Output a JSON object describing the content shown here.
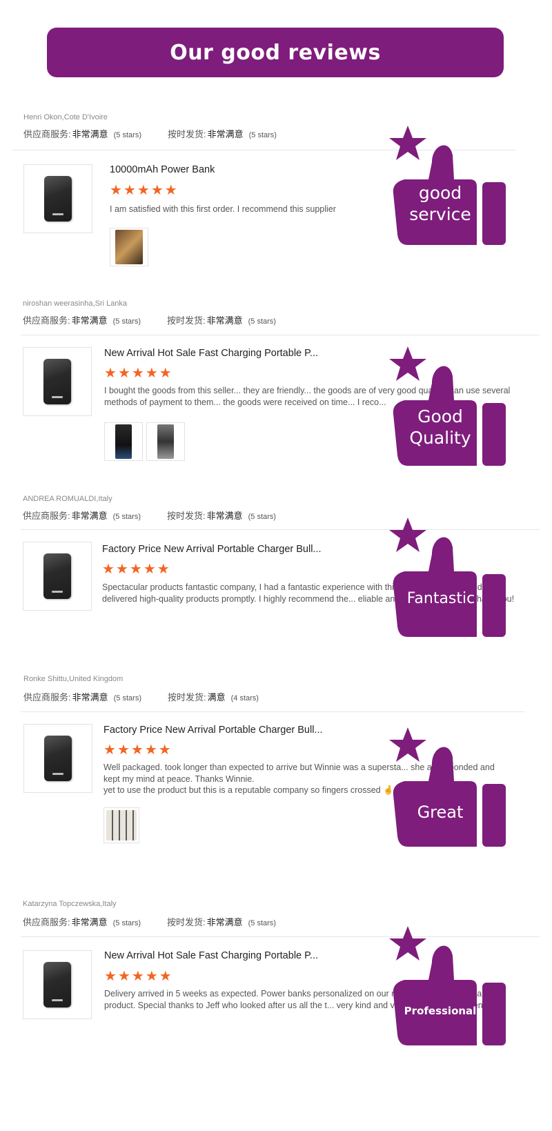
{
  "header": {
    "title": "Our good reviews"
  },
  "labels": {
    "supplier_service": "供应商服务:",
    "on_time_delivery": "按时发货:"
  },
  "colors": {
    "brand": "#7e1d7c",
    "star": "#f26522"
  },
  "reviews": [
    {
      "reviewer": "Henri Okon,Cote D'Ivoire",
      "supplier_value": "非常满意",
      "supplier_stars": "(5 stars)",
      "delivery_value": "非常满意",
      "delivery_stars": "(5 stars)",
      "product_title": "10000mAh Power Bank",
      "rating": 5,
      "comment": "I am satisfied with this first order. I recommend this supplier",
      "badge": "good service"
    },
    {
      "reviewer": "niroshan weerasinha,Sri Lanka",
      "supplier_value": "非常满意",
      "supplier_stars": "(5 stars)",
      "delivery_value": "非常满意",
      "delivery_stars": "(5 stars)",
      "product_title": "New Arrival Hot Sale Fast Charging Portable P...",
      "rating": 5,
      "comment": "I bought the goods from this seller... they are friendly... the goods are of very good qua... u can use several methods of payment to them... the goods were received on time... I reco...",
      "badge": "Good Quality"
    },
    {
      "reviewer": "ANDREA ROMUALDI,Italy",
      "supplier_value": "非常满意",
      "supplier_stars": "(5 stars)",
      "delivery_value": "非常满意",
      "delivery_stars": "(5 stars)",
      "product_title": "Factory Price New Arrival Portable Charger Bull...",
      "rating": 5,
      "comment": "Spectacular products fantastic company, I had a fantastic experience with this s... op ch service and delivered high-quality products promptly. I highly recommend the... eliable and trustworthy seller. Thank you!",
      "badge": "Fantastic"
    },
    {
      "reviewer": "Ronke Shittu,United Kingdom",
      "supplier_value": "非常满意",
      "supplier_stars": "(5 stars)",
      "delivery_value": "满意",
      "delivery_stars": "(4 stars)",
      "product_title": "Factory Price New Arrival Portable Charger Bull...",
      "rating": 5,
      "comment_lines": [
        "Well packaged. took longer than expected to arrive but Winnie was a supersta... she alw... ponded and",
        "kept my mind at peace. Thanks Winnie.",
        "yet to use the product but this is a reputable company so fingers crossed 🤞"
      ],
      "badge": "Great"
    },
    {
      "reviewer": "Katarzyna Topczewska,Italy",
      "supplier_value": "非常满意",
      "supplier_stars": "(5 stars)",
      "delivery_value": "非常满意",
      "delivery_stars": "(5 stars)",
      "product_title": "New Arrival Hot Sale Fast Charging Portable P...",
      "rating": 5,
      "comment": "Delivery arrived in 5 weeks as expected. Power banks personalized on our rec... n t quality, very valid product. Special thanks to Jeff who looked after us all the t... very kind and very helpful. Compliments !",
      "badge": "Professional"
    }
  ]
}
